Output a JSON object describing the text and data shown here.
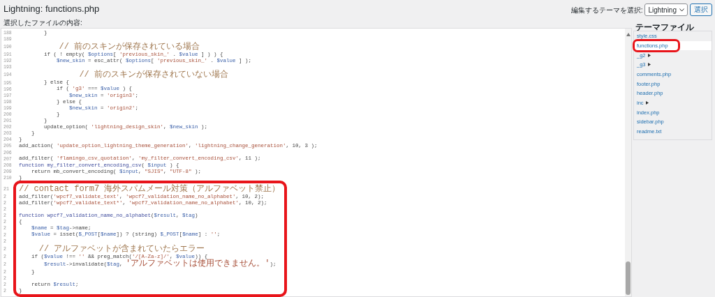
{
  "header": {
    "title": "Lightning: functions.php",
    "content_label": "選択したファイルの内容:",
    "theme_label": "編集するテーマを選択:",
    "theme_select": "Lightning",
    "select_button": "選択"
  },
  "code": {
    "blocks": [
      {
        "circled": false,
        "lines": [
          {
            "number": "188",
            "tokens": [
              {
                "kind": "plain",
                "text": "        }"
              }
            ]
          },
          {
            "number": "189"
          },
          {
            "number": "190",
            "tokens": [
              {
                "kind": "comment",
                "text": "        // 前のスキンが保存されている場合"
              }
            ]
          },
          {
            "number": "191",
            "tokens": [
              {
                "kind": "plain",
                "text": "        if ( ! empty( "
              },
              {
                "kind": "var",
                "text": "$options"
              },
              {
                "kind": "plain",
                "text": "[ "
              },
              {
                "kind": "string",
                "text": "'previous_skin_'"
              },
              {
                "kind": "plain",
                "text": " . "
              },
              {
                "kind": "var",
                "text": "$value"
              },
              {
                "kind": "plain",
                "text": " ] ) ) {"
              }
            ]
          },
          {
            "number": "192",
            "tokens": [
              {
                "kind": "var",
                "text": "            $new_skin"
              },
              {
                "kind": "plain",
                "text": " = esc_attr( "
              },
              {
                "kind": "var",
                "text": "$options"
              },
              {
                "kind": "plain",
                "text": "[ "
              },
              {
                "kind": "string",
                "text": "'previous_skin_'"
              },
              {
                "kind": "plain",
                "text": " . "
              },
              {
                "kind": "var",
                "text": "$value"
              },
              {
                "kind": "plain",
                "text": " ] );"
              }
            ]
          },
          {
            "number": "193"
          },
          {
            "number": "194",
            "tokens": [
              {
                "kind": "comment",
                "text": "            // 前のスキンが保存されていない場合"
              }
            ]
          },
          {
            "number": "195",
            "tokens": [
              {
                "kind": "plain",
                "text": "        } else {"
              }
            ]
          },
          {
            "number": "196",
            "tokens": [
              {
                "kind": "plain",
                "text": "            if ( "
              },
              {
                "kind": "string",
                "text": "'g3'"
              },
              {
                "kind": "plain",
                "text": " === "
              },
              {
                "kind": "var",
                "text": "$value"
              },
              {
                "kind": "plain",
                "text": " ) {"
              }
            ]
          },
          {
            "number": "197",
            "tokens": [
              {
                "kind": "var",
                "text": "                $new_skin"
              },
              {
                "kind": "plain",
                "text": " = "
              },
              {
                "kind": "string",
                "text": "'origin3'"
              },
              {
                "kind": "plain",
                "text": ";"
              }
            ]
          },
          {
            "number": "198",
            "tokens": [
              {
                "kind": "plain",
                "text": "            } else {"
              }
            ]
          },
          {
            "number": "199",
            "tokens": [
              {
                "kind": "var",
                "text": "                $new_skin"
              },
              {
                "kind": "plain",
                "text": " = "
              },
              {
                "kind": "string",
                "text": "'origin2'"
              },
              {
                "kind": "plain",
                "text": ";"
              }
            ]
          },
          {
            "number": "200",
            "tokens": [
              {
                "kind": "plain",
                "text": "            }"
              }
            ]
          },
          {
            "number": "201",
            "tokens": [
              {
                "kind": "plain",
                "text": "        }"
              }
            ]
          },
          {
            "number": "202",
            "tokens": [
              {
                "kind": "plain",
                "text": "        update_option( "
              },
              {
                "kind": "string",
                "text": "'lightning_design_skin'"
              },
              {
                "kind": "plain",
                "text": ", "
              },
              {
                "kind": "var",
                "text": "$new_skin"
              },
              {
                "kind": "plain",
                "text": " );"
              }
            ]
          },
          {
            "number": "203",
            "tokens": [
              {
                "kind": "plain",
                "text": "    }"
              }
            ]
          },
          {
            "number": "204",
            "tokens": [
              {
                "kind": "plain",
                "text": "}"
              }
            ]
          },
          {
            "number": "205",
            "tokens": [
              {
                "kind": "plain",
                "text": "add_action( "
              },
              {
                "kind": "string",
                "text": "'update_option_lightning_theme_generation'"
              },
              {
                "kind": "plain",
                "text": ", "
              },
              {
                "kind": "string",
                "text": "'lightning_change_generation'"
              },
              {
                "kind": "plain",
                "text": ", 10, 3 );"
              }
            ]
          },
          {
            "number": "206"
          },
          {
            "number": "207",
            "tokens": [
              {
                "kind": "plain",
                "text": "add_filter( "
              },
              {
                "kind": "string",
                "text": "'flamingo_csv_quotation'"
              },
              {
                "kind": "plain",
                "text": ", "
              },
              {
                "kind": "string",
                "text": "'my_filter_convert_encoding_csv'"
              },
              {
                "kind": "plain",
                "text": ", 11 );"
              }
            ]
          },
          {
            "number": "208",
            "tokens": [
              {
                "kind": "keyword",
                "text": "function my_filter_convert_encoding_csv"
              },
              {
                "kind": "plain",
                "text": "( "
              },
              {
                "kind": "var",
                "text": "$input"
              },
              {
                "kind": "plain",
                "text": " ) {"
              }
            ]
          },
          {
            "number": "209",
            "tokens": [
              {
                "kind": "plain",
                "text": "    return mb_convert_encoding( "
              },
              {
                "kind": "var",
                "text": "$input"
              },
              {
                "kind": "plain",
                "text": ", "
              },
              {
                "kind": "string",
                "text": "\"SJIS\""
              },
              {
                "kind": "plain",
                "text": ", "
              },
              {
                "kind": "string",
                "text": "\"UTF-8\""
              },
              {
                "kind": "plain",
                "text": " );"
              }
            ]
          },
          {
            "number": "210",
            "tokens": [
              {
                "kind": "plain",
                "text": "}"
              }
            ]
          }
        ]
      },
      {
        "circled": true,
        "lines": [
          {
            "number": "21",
            "tokens": [
              {
                "kind": "comment",
                "text": "// contact form7 海外スパムメール対策（アルファベット禁止）"
              }
            ]
          },
          {
            "number": "2",
            "tokens": [
              {
                "kind": "plain",
                "text": "add_filter("
              },
              {
                "kind": "string",
                "text": "'wpcf7_validate_text'"
              },
              {
                "kind": "plain",
                "text": ", "
              },
              {
                "kind": "string",
                "text": "'wpcf7_validation_name_no_alphabet'"
              },
              {
                "kind": "plain",
                "text": ", 10, 2);"
              }
            ]
          },
          {
            "number": "2",
            "tokens": [
              {
                "kind": "plain",
                "text": "add_filter("
              },
              {
                "kind": "string",
                "text": "'wpcf7_validate_text*'"
              },
              {
                "kind": "plain",
                "text": ", "
              },
              {
                "kind": "string",
                "text": "'wpcf7_validation_name_no_alphabet'"
              },
              {
                "kind": "plain",
                "text": ", 10, 2);"
              }
            ]
          },
          {
            "number": "2"
          },
          {
            "number": "2",
            "tokens": [
              {
                "kind": "keyword",
                "text": "function wpcf7_validation_name_no_alphabet"
              },
              {
                "kind": "plain",
                "text": "("
              },
              {
                "kind": "var",
                "text": "$result"
              },
              {
                "kind": "plain",
                "text": ", "
              },
              {
                "kind": "var",
                "text": "$tag"
              },
              {
                "kind": "plain",
                "text": ")"
              }
            ]
          },
          {
            "number": "2",
            "tokens": [
              {
                "kind": "plain",
                "text": "{"
              }
            ]
          },
          {
            "number": "2",
            "tokens": [
              {
                "kind": "var",
                "text": "    $name"
              },
              {
                "kind": "plain",
                "text": " = "
              },
              {
                "kind": "var",
                "text": "$tag"
              },
              {
                "kind": "plain",
                "text": "->name;"
              }
            ]
          },
          {
            "number": "2",
            "tokens": [
              {
                "kind": "var",
                "text": "    $value"
              },
              {
                "kind": "plain",
                "text": " = isset("
              },
              {
                "kind": "var",
                "text": "$_POST"
              },
              {
                "kind": "plain",
                "text": "["
              },
              {
                "kind": "var",
                "text": "$name"
              },
              {
                "kind": "plain",
                "text": "]) ? (string) "
              },
              {
                "kind": "var",
                "text": "$_POST"
              },
              {
                "kind": "plain",
                "text": "["
              },
              {
                "kind": "var",
                "text": "$name"
              },
              {
                "kind": "plain",
                "text": "] : "
              },
              {
                "kind": "string",
                "text": "''"
              },
              {
                "kind": "plain",
                "text": ";"
              }
            ]
          },
          {
            "number": "2"
          },
          {
            "number": "2",
            "tokens": [
              {
                "kind": "comment",
                "text": "    // アルファベットが含まれていたらエラー"
              }
            ]
          },
          {
            "number": "2",
            "tokens": [
              {
                "kind": "plain",
                "text": "    if ("
              },
              {
                "kind": "var",
                "text": "$value"
              },
              {
                "kind": "plain",
                "text": " !== "
              },
              {
                "kind": "string",
                "text": "''"
              },
              {
                "kind": "plain",
                "text": " && preg_match("
              },
              {
                "kind": "string",
                "text": "'/[A-Za-z]/'"
              },
              {
                "kind": "plain",
                "text": ", "
              },
              {
                "kind": "var",
                "text": "$value"
              },
              {
                "kind": "plain",
                "text": ")) {"
              }
            ]
          },
          {
            "number": "2",
            "tokens": [
              {
                "kind": "var",
                "text": "        $result"
              },
              {
                "kind": "plain",
                "text": "->invalidate("
              },
              {
                "kind": "var",
                "text": "$tag"
              },
              {
                "kind": "plain",
                "text": ", "
              },
              {
                "kind": "string",
                "text": "'アルファベットは使用できません。'"
              },
              {
                "kind": "plain",
                "text": ");"
              }
            ]
          },
          {
            "number": "2",
            "tokens": [
              {
                "kind": "plain",
                "text": "    }"
              }
            ]
          },
          {
            "number": "2"
          },
          {
            "number": "2",
            "tokens": [
              {
                "kind": "plain",
                "text": "    return "
              },
              {
                "kind": "var",
                "text": "$result"
              },
              {
                "kind": "plain",
                "text": ";"
              }
            ]
          },
          {
            "number": "2",
            "tokens": [
              {
                "kind": "plain",
                "text": "}"
              }
            ]
          }
        ]
      }
    ]
  },
  "sidebar": {
    "title": "テーマファイル",
    "items": [
      {
        "kind": "file",
        "label": "style.css",
        "selected": false,
        "circled": false
      },
      {
        "kind": "file",
        "label": "functions.php",
        "selected": true,
        "circled": true
      },
      {
        "kind": "folder",
        "label": "_g2",
        "selected": false,
        "circled": false
      },
      {
        "kind": "folder",
        "label": "_g3",
        "selected": false,
        "circled": false
      },
      {
        "kind": "file",
        "label": "comments.php",
        "selected": false,
        "circled": false
      },
      {
        "kind": "file",
        "label": "footer.php",
        "selected": false,
        "circled": false
      },
      {
        "kind": "file",
        "label": "header.php",
        "selected": false,
        "circled": false
      },
      {
        "kind": "folder",
        "label": "inc",
        "selected": false,
        "circled": false
      },
      {
        "kind": "file",
        "label": "index.php",
        "selected": false,
        "circled": false
      },
      {
        "kind": "file",
        "label": "sidebar.php",
        "selected": false,
        "circled": false
      },
      {
        "kind": "file",
        "label": "readme.txt",
        "selected": false,
        "circled": false
      }
    ]
  }
}
